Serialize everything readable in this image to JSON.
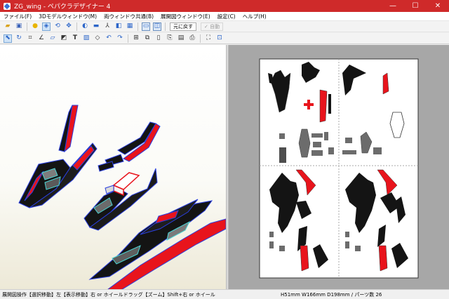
{
  "window": {
    "title": "ZG_wing - ペパクラデザイナー 4",
    "minimize": "—",
    "maximize": "☐",
    "close": "✕"
  },
  "menu": {
    "items": [
      "ファイル(F)",
      "3Dモデルウィンドウ(M)",
      "両ウィンドウ共通(B)",
      "展開図ウィンドウ(E)",
      "設定(C)",
      "ヘルプ(H)"
    ]
  },
  "toolbar": {
    "undo_label": "元に戻す",
    "auto_label": "✓ 自動"
  },
  "status": {
    "left": "展開図操作【選択移動】左【表示移動】右 or ホイールドラッグ【ズーム】Shift+右 or ホイール",
    "right": "H51mm W166mm D198mm / パーツ数 26"
  },
  "colors": {
    "titlebar": "#cf2a2a",
    "model_body": "#141414",
    "model_accent": "#e8141c",
    "model_edge": "#2a3fe0",
    "model_highlight": "#4ad6d6",
    "paper": "#ffffff",
    "workspace": "#a7a7a7"
  },
  "icons": [
    "open-icon",
    "save-icon",
    "light-icon",
    "texture-icon",
    "rotate-icon",
    "move-icon",
    "paint-icon",
    "cylinder-icon",
    "axis-icon",
    "edge-icon",
    "part-icon",
    "window-3d-icon",
    "window-2d-icon"
  ]
}
